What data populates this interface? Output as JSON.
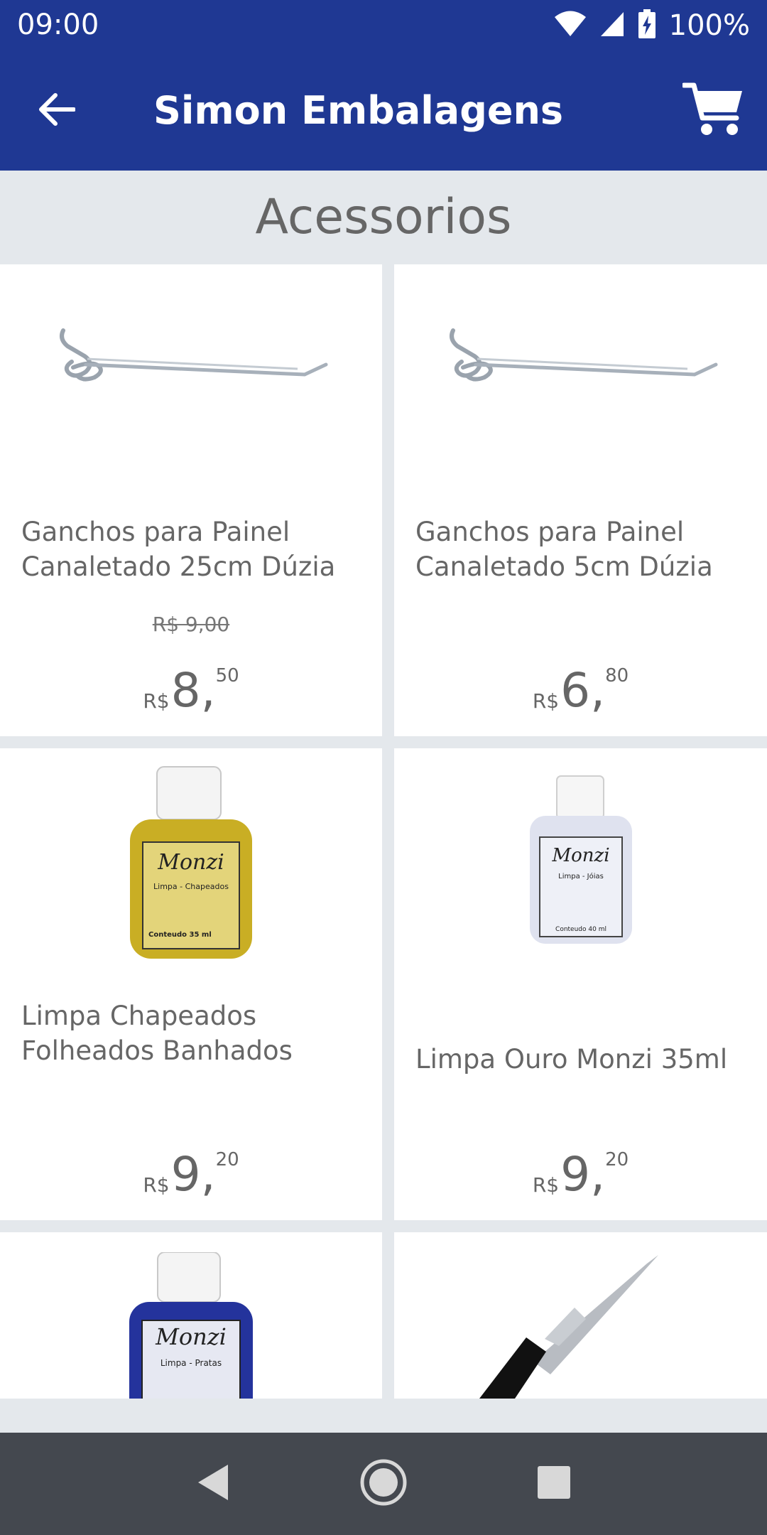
{
  "status_bar": {
    "time": "09:00",
    "battery_percent": "100%",
    "icons": [
      "wifi-icon",
      "signal-icon",
      "battery-charging-icon"
    ]
  },
  "app_bar": {
    "title": "Simon Embalagens",
    "back_icon": "back-arrow-icon",
    "cart_icon": "shopping-cart-icon"
  },
  "category": {
    "title": "Acessorios"
  },
  "products": [
    {
      "name": "Ganchos para Painel Canaletado 25cm Dúzia",
      "old_price": "R$ 9,00",
      "currency": "R$",
      "price_int": "8,",
      "price_cents": "50",
      "image": "hook-image"
    },
    {
      "name": "Ganchos para Painel Canaletado 5cm Dúzia",
      "old_price": "",
      "currency": "R$",
      "price_int": "6,",
      "price_cents": "80",
      "image": "hook-image"
    },
    {
      "name": "Limpa Chapeados Folheados Banhados",
      "old_price": "",
      "currency": "R$",
      "price_int": "9,",
      "price_cents": "20",
      "image": "yellow-bottle-image"
    },
    {
      "name": "Limpa Ouro Monzi 35ml",
      "old_price": "",
      "currency": "R$",
      "price_int": "9,",
      "price_cents": "20",
      "image": "clear-bottle-image"
    },
    {
      "image": "blue-bottle-image"
    },
    {
      "image": "ring-stick-image"
    }
  ],
  "product_labels": {
    "yellow_bottle": {
      "brand": "Monzi",
      "line": "Limpa - Chapeados",
      "content": "Conteudo 35 ml"
    },
    "clear_bottle": {
      "brand": "Monzi",
      "line": "Limpa - Jóias",
      "content": "Conteudo 40 ml"
    },
    "blue_bottle": {
      "brand": "Monzi",
      "line": "Limpa - Pratas"
    }
  },
  "nav_bar": {
    "icons": [
      "nav-back-icon",
      "nav-home-icon",
      "nav-recents-icon"
    ]
  },
  "colors": {
    "primary": "#1f3893",
    "background": "#e4e8ec",
    "card": "#ffffff",
    "text": "#666666",
    "navbar": "#44484f"
  }
}
